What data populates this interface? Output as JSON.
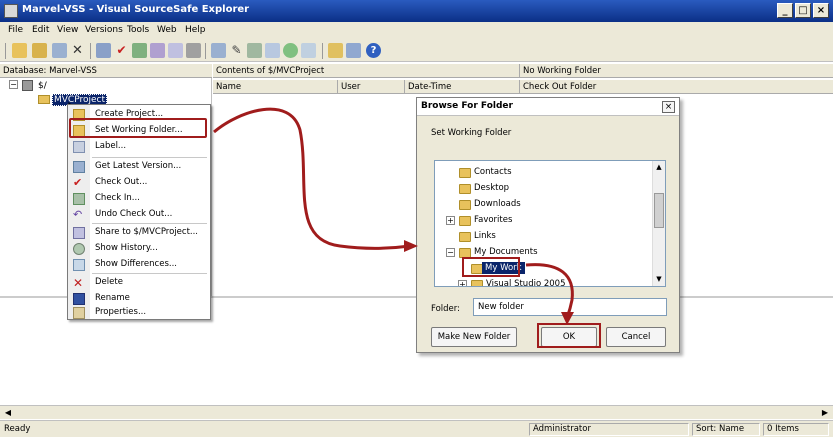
{
  "window": {
    "title": "Marvel-VSS - Visual SourceSafe Explorer",
    "controls": [
      "_",
      "□",
      "×"
    ]
  },
  "menubar": [
    "File",
    "Edit",
    "View",
    "Versions",
    "Tools",
    "Web",
    "Help"
  ],
  "left_pane": {
    "header": "Database: Marvel-VSS",
    "root": "$/",
    "selected_project": "MVCProject"
  },
  "right_pane": {
    "header_left": "Contents of $/MVCProject",
    "header_right": "No Working Folder",
    "columns": [
      "Name",
      "User",
      "Date-Time",
      "Check Out Folder"
    ]
  },
  "context_menu": {
    "items": [
      {
        "label": "Create Project...",
        "icon": "new-project-icon"
      },
      {
        "label": "Set Working Folder...",
        "icon": "working-folder-icon"
      },
      {
        "label": "Label...",
        "icon": "label-icon"
      },
      {
        "label": "Get Latest Version...",
        "icon": "get-latest-icon"
      },
      {
        "label": "Check Out...",
        "icon": "check-out-icon"
      },
      {
        "label": "Check In...",
        "icon": "check-in-icon"
      },
      {
        "label": "Undo Check Out...",
        "icon": "undo-checkout-icon"
      },
      {
        "label": "Share to $/MVCProject...",
        "icon": "share-icon"
      },
      {
        "label": "Show History...",
        "icon": "history-icon"
      },
      {
        "label": "Show Differences...",
        "icon": "differences-icon"
      },
      {
        "label": "Delete",
        "icon": "delete-icon"
      },
      {
        "label": "Rename",
        "icon": "rename-icon"
      },
      {
        "label": "Properties...",
        "icon": "properties-icon"
      }
    ]
  },
  "dialog": {
    "title": "Browse For Folder",
    "instruction": "Set Working Folder",
    "tree": [
      "Contacts",
      "Desktop",
      "Downloads",
      "Favorites",
      "Links",
      "My Documents",
      "My Work",
      "Visual Studio 2005"
    ],
    "folder_label": "Folder:",
    "folder_value": "New folder",
    "make_new_folder": "Make New Folder",
    "ok": "OK",
    "cancel": "Cancel"
  },
  "status": {
    "left": "Ready",
    "user": "Administrator",
    "sort": "Sort: Name",
    "count": "0 Items"
  },
  "colors": {
    "highlight": "#a01c1c",
    "selection": "#0a246a",
    "titlebar": "#0b2f86"
  }
}
